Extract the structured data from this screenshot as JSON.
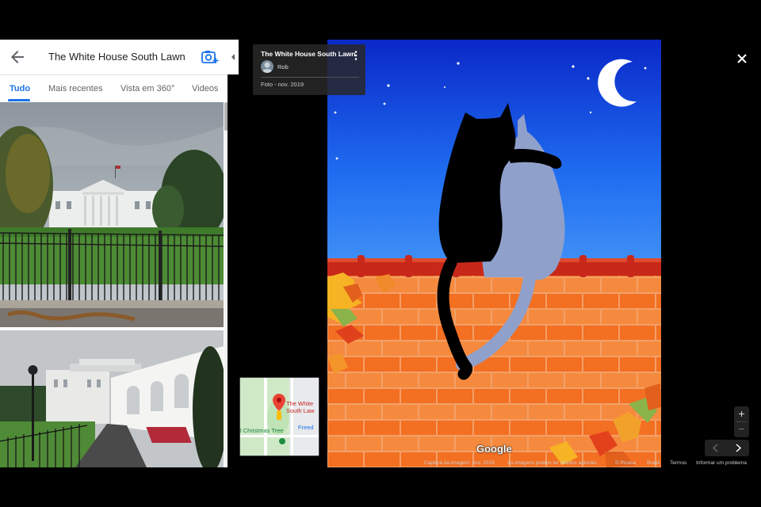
{
  "panel": {
    "title": "The White House South Lawn",
    "tabs": [
      {
        "label": "Tudo",
        "active": true
      },
      {
        "label": "Mais recentes",
        "active": false
      },
      {
        "label": "Vista em 360°",
        "active": false
      },
      {
        "label": "Videos",
        "active": false
      }
    ]
  },
  "info_card": {
    "title": "The White House South Lawn",
    "author": "Rob",
    "date": "Foto - nov. 2019"
  },
  "minimap": {
    "place_label": "The White South Law",
    "tree_label": "l Christmas Tree",
    "road_label": "Freed"
  },
  "logo": "Google",
  "zoom": {
    "in": "+",
    "out": "−"
  },
  "footer": {
    "capture": "Captura da imagem: nov. 2019",
    "rights": "As imagens podem ter direitos autorais.",
    "picasa": "© Picasa",
    "country": "Brasil",
    "terms": "Termos",
    "report": "Informar um problema"
  },
  "colors": {
    "accent": "#1a73e8",
    "sky": "#1f6bf0",
    "brick": "#f0732a"
  }
}
